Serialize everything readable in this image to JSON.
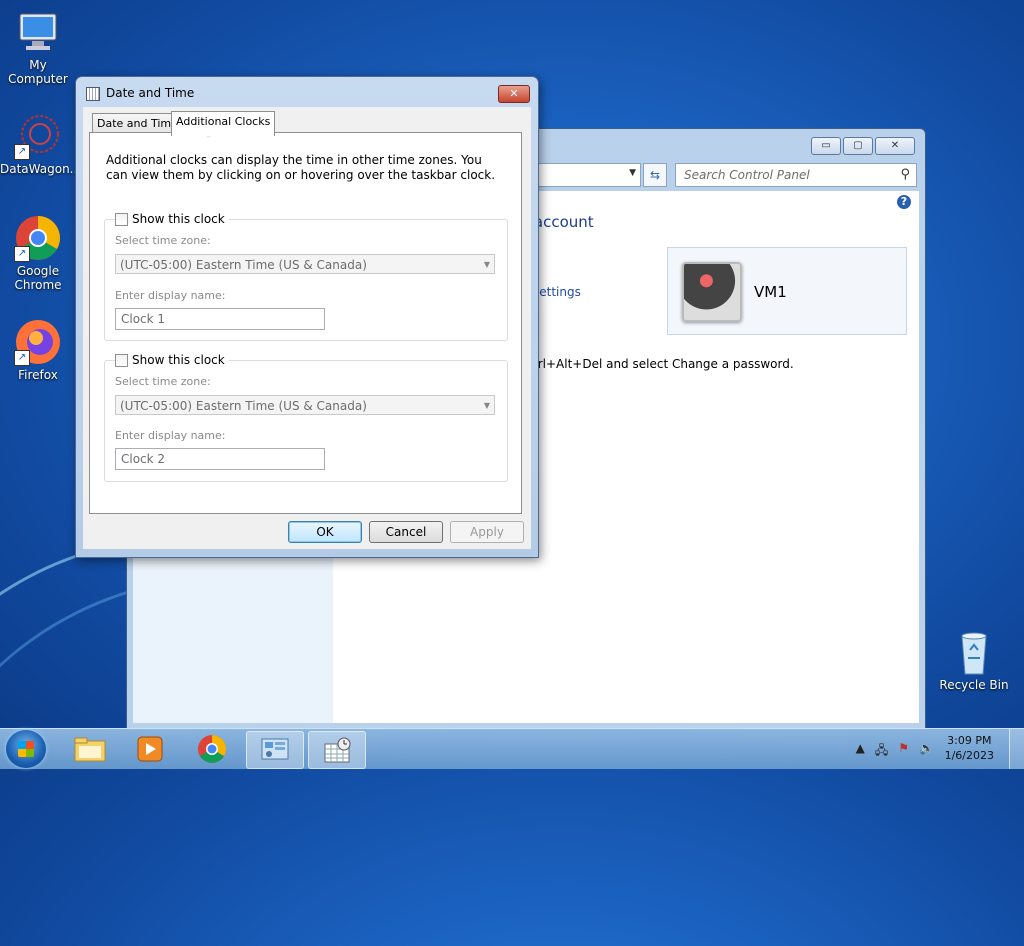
{
  "desktop": {
    "icons": [
      {
        "label": "My Computer"
      },
      {
        "label": "DataWagon..."
      },
      {
        "label": "Google Chrome"
      },
      {
        "label": "Firefox"
      },
      {
        "label": "Recycle Bin"
      }
    ]
  },
  "control_panel": {
    "search_placeholder": "Search Control Panel",
    "heading_fragment": "r account",
    "link_fragment": "settings",
    "user_name": "VM1",
    "note_fragment": "trl+Alt+Del and select Change a password.",
    "caption_buttons": {
      "minimize": "▭",
      "maximize": "▢",
      "close": "✕"
    }
  },
  "dialog": {
    "title": "Date and Time",
    "close_glyph": "✕",
    "tabs": [
      {
        "label": "Date and Time",
        "active": false
      },
      {
        "label": "Additional Clocks",
        "active": true
      }
    ],
    "description": "Additional clocks can display the time in other time zones. You can view them by clicking on or hovering over the taskbar clock.",
    "clocks": [
      {
        "show_label": "Show this clock",
        "checked": false,
        "timezone_label": "Select time zone:",
        "timezone_value": "(UTC-05:00) Eastern Time (US & Canada)",
        "name_label": "Enter display name:",
        "name_value": "Clock 1"
      },
      {
        "show_label": "Show this clock",
        "checked": false,
        "timezone_label": "Select time zone:",
        "timezone_value": "(UTC-05:00) Eastern Time (US & Canada)",
        "name_label": "Enter display name:",
        "name_value": "Clock 2"
      }
    ],
    "buttons": {
      "ok": "OK",
      "cancel": "Cancel",
      "apply": "Apply"
    }
  },
  "taskbar": {
    "items": [
      {
        "icon": "folder-icon"
      },
      {
        "icon": "media-player-icon"
      },
      {
        "icon": "chrome-icon"
      },
      {
        "icon": "control-panel-icon"
      },
      {
        "icon": "date-time-icon"
      }
    ],
    "time": "3:09 PM",
    "date": "1/6/2023"
  },
  "colors": {
    "accent": "#3c7fb1",
    "link": "#1f4aa8",
    "close_red": "#c6452f"
  }
}
